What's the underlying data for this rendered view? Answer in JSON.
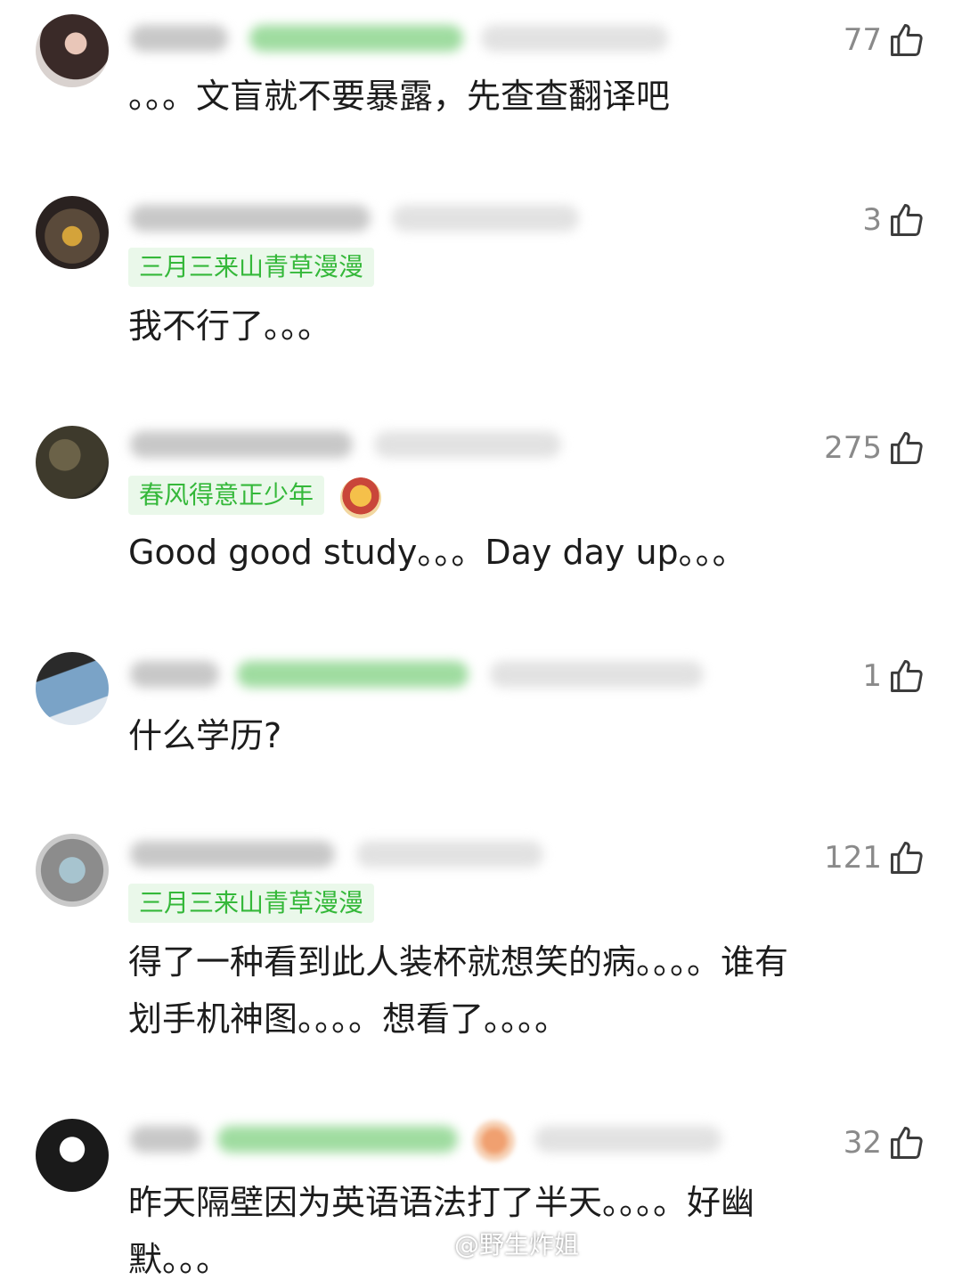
{
  "comments": [
    {
      "likes": "77",
      "tag": "",
      "text": "。。。文盲就不要暴露，先查查翻译吧"
    },
    {
      "likes": "3",
      "tag": "三月三来山青草漫漫",
      "text": "我不行了。。。"
    },
    {
      "likes": "275",
      "tag": "春风得意正少年",
      "text": "Good good study。。。Day day up。。。"
    },
    {
      "likes": "1",
      "tag": "",
      "text": "什么学历?"
    },
    {
      "likes": "121",
      "tag": "三月三来山青草漫漫",
      "text": "得了一种看到此人装杯就想笑的病。。。。谁有\n划手机神图。。。。想看了。。。。"
    },
    {
      "likes": "32",
      "tag": "",
      "text": "昨天隔壁因为英语语法打了半天。。。。好幽\n默。。。"
    }
  ],
  "watermark": {
    "text": "@野生炸姐",
    "icon": "weibo-icon"
  },
  "colors": {
    "tag_bg": "#eaf8ea",
    "tag_text": "#35b83a",
    "likes": "#8a8a8a"
  }
}
